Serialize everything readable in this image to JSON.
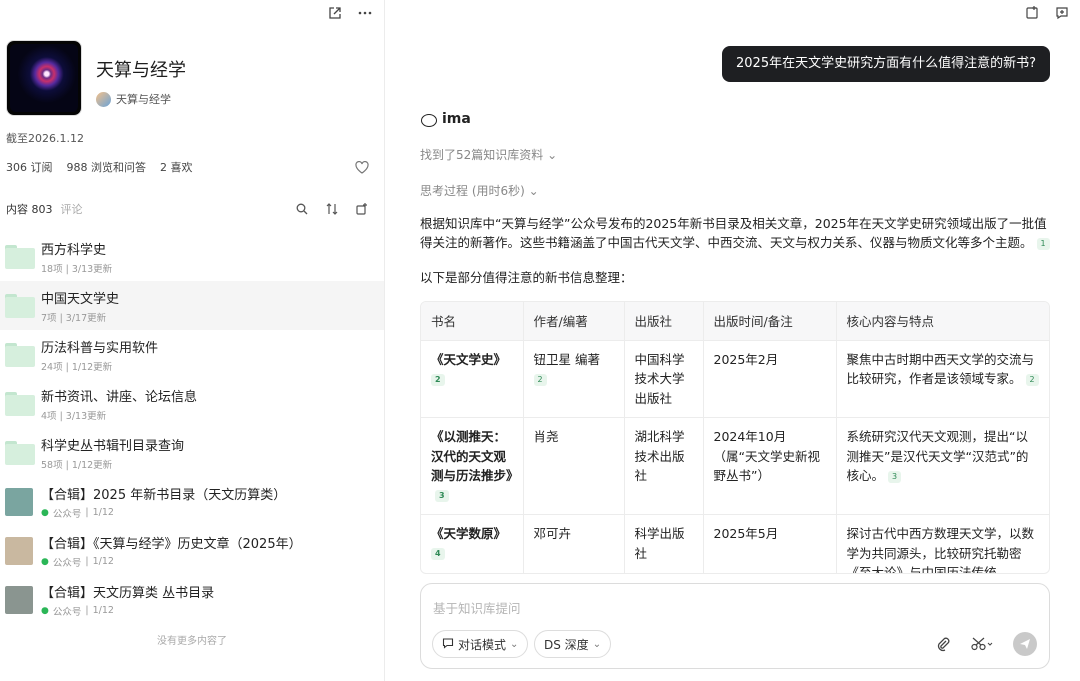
{
  "kb": {
    "title": "天算与经学",
    "owner": "天算与经学",
    "updated": "截至2026.1.12",
    "stats": {
      "subs": "306 订阅",
      "views": "988 浏览和问答",
      "likes": "2 喜欢"
    },
    "tabs": {
      "content": "内容 803",
      "comments": "评论"
    }
  },
  "items": [
    {
      "name": "西方科学史",
      "meta": "18项 | 3/13更新",
      "type": "folder"
    },
    {
      "name": "中国天文学史",
      "meta": "7项 | 3/17更新",
      "type": "folder"
    },
    {
      "name": "历法科普与实用软件",
      "meta": "24项 | 1/12更新",
      "type": "folder"
    },
    {
      "name": "新书资讯、讲座、论坛信息",
      "meta": "4项 | 3/13更新",
      "type": "folder"
    },
    {
      "name": "科学史丛书辑刊目录查询",
      "meta": "58项 | 1/12更新",
      "type": "folder"
    },
    {
      "name": "【合辑】2025 年新书目录（天文历算类）",
      "source": "公众号",
      "date": "1/12",
      "type": "article",
      "thumb": "#7aa5a0"
    },
    {
      "name": "【合辑】《天算与经学》历史文章（2025年）",
      "source": "公众号",
      "date": "1/12",
      "type": "article",
      "thumb": "#c9b8a0"
    },
    {
      "name": "【合辑】天文历算类 丛书目录",
      "source": "公众号",
      "date": "1/12",
      "type": "article",
      "thumb": "#8a9590"
    }
  ],
  "no_more": "没有更多内容了",
  "chat": {
    "question": "2025年在天文学史研究方面有什么值得注意的新书?",
    "bot_name": "ima",
    "found": "找到了52篇知识库资料",
    "thinking": "思考过程 (用时6秒)",
    "para1": "根据知识库中“天算与经学”公众号发布的2025年新书目录及相关文章，2025年在天文学史研究领域出版了一批值得关注的新著作。这些书籍涵盖了中国古代天文学、中西交流、天文与权力关系、仪器与物质文化等多个主题。",
    "para1_cite": "1",
    "para2": "以下是部分值得注意的新书信息整理：",
    "table": {
      "headers": [
        "书名",
        "作者/编著",
        "出版社",
        "出版时间/备注",
        "核心内容与特点"
      ],
      "rows": [
        {
          "title": "《天文学史》",
          "title_cite": "2",
          "author": "钮卫星 编著",
          "author_cite": "2",
          "publisher": "中国科学技术大学出版社",
          "time": "2025年2月",
          "desc": "聚焦中古时期中西天文学的交流与比较研究，作者是该领域专家。",
          "desc_cite": "2"
        },
        {
          "title": "《以测推天：汉代的天文观测与历法推步》",
          "title_cite": "3",
          "author": "肖尧",
          "publisher": "湖北科学技术出版社",
          "time": "2024年10月（属“天文学史新视野丛书”）",
          "desc": "系统研究汉代天文观测，提出“以测推天”是汉代天文学“汉范式”的核心。",
          "desc_cite": "3"
        },
        {
          "title": "《天学数原》",
          "title_cite": "4",
          "author": "邓可卉",
          "publisher": "科学出版社",
          "time": "2025年5月",
          "desc": "探讨古代中西方数理天文学，以数学为共同源头，比较研究托勒密《至大论》与中国历法传统"
        }
      ]
    },
    "composer": {
      "placeholder": "基于知识库提问",
      "mode": "对话模式",
      "model": "DS 深度"
    }
  }
}
